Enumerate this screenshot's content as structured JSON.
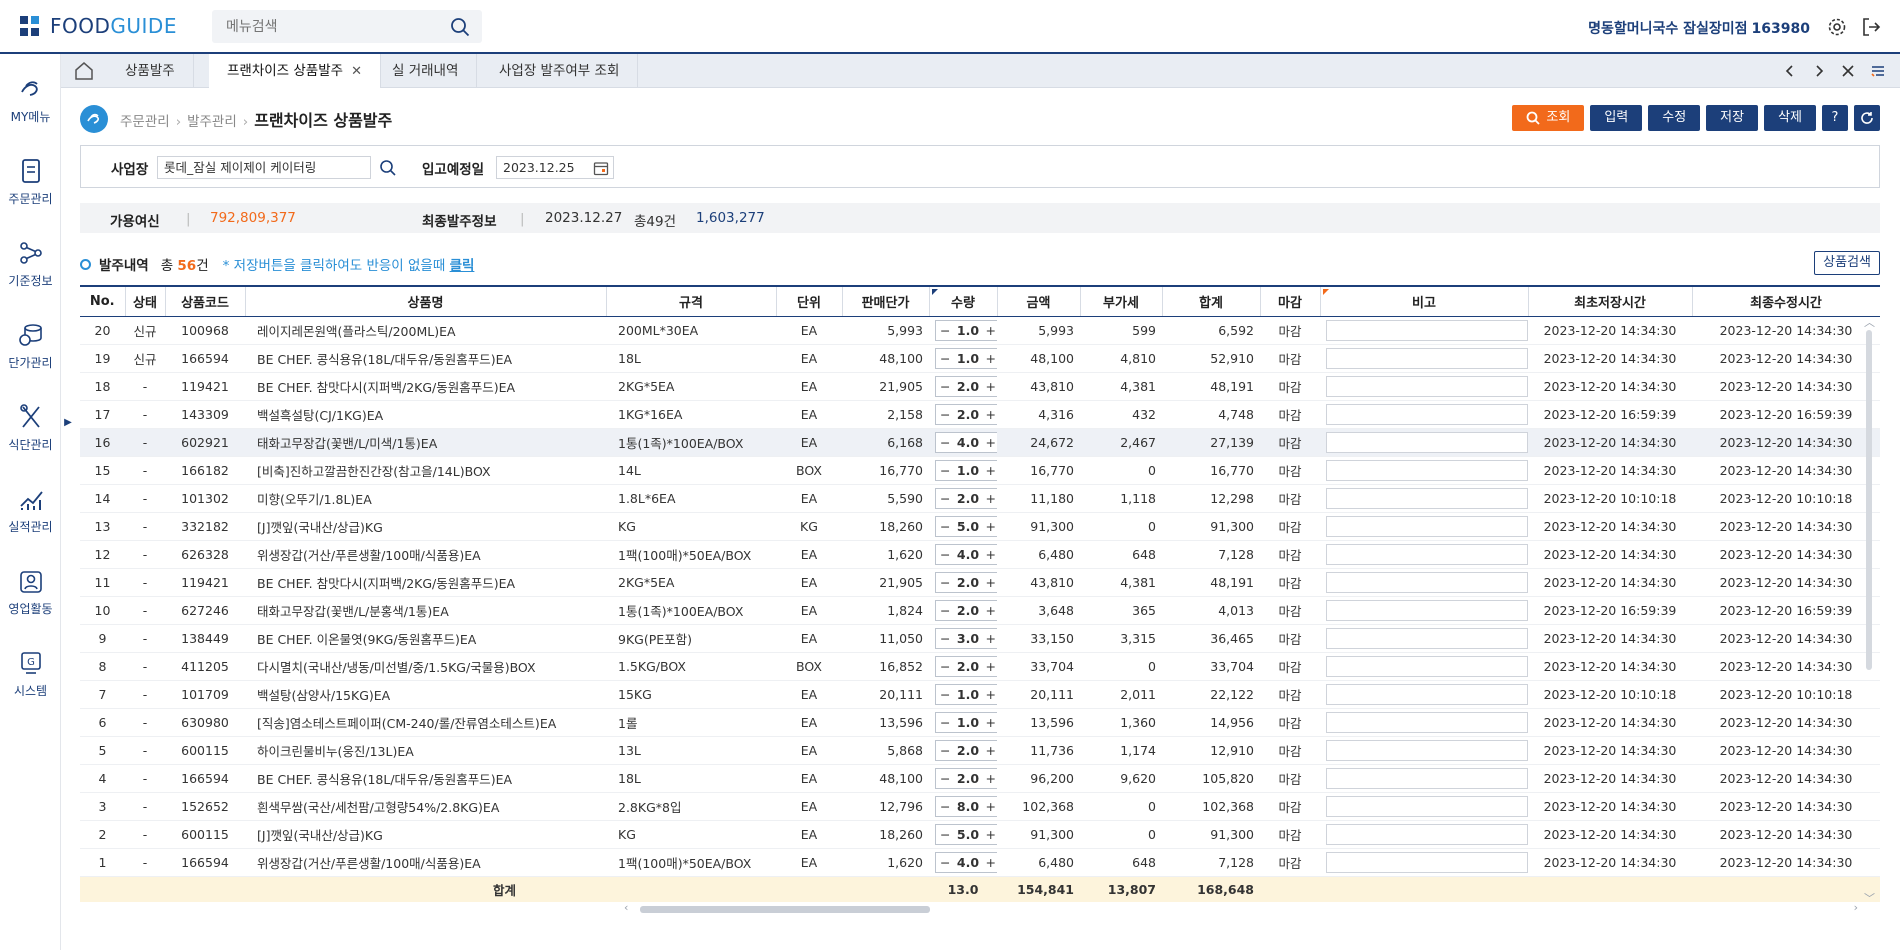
{
  "app": {
    "logo_text_a": "FOOD",
    "logo_text_b": "GUIDE"
  },
  "search": {
    "placeholder": "메뉴검색"
  },
  "user": {
    "name": "명동할머니국수 잠실장미점",
    "code": "163980"
  },
  "sidebar": [
    {
      "label": "MY메뉴",
      "icon": "heart-hands-icon"
    },
    {
      "label": "주문관리",
      "icon": "order-document-icon"
    },
    {
      "label": "기준정보",
      "icon": "share-nodes-icon"
    },
    {
      "label": "단가관리",
      "icon": "coins-icon"
    },
    {
      "label": "식단관리",
      "icon": "fork-spoon-icon"
    },
    {
      "label": "실적관리",
      "icon": "chart-line-icon"
    },
    {
      "label": "영업활동",
      "icon": "person-id-icon"
    },
    {
      "label": "시스템",
      "icon": "system-g-icon"
    }
  ],
  "tabs": [
    {
      "label": "상품발주",
      "active": false,
      "closable": false
    },
    {
      "label": "프랜차이즈 상품발주",
      "active": true,
      "closable": true
    },
    {
      "label": "실 거래내역",
      "active": false,
      "closable": false
    },
    {
      "label": "사업장 발주여부 조회",
      "active": false,
      "closable": false
    }
  ],
  "breadcrumb": {
    "level1": "주문관리",
    "level2": "발주관리",
    "current": "프랜차이즈 상품발주"
  },
  "toolbar": {
    "query": "조회",
    "input": "입력",
    "edit": "수정",
    "save": "저장",
    "delete": "삭제",
    "help": "?"
  },
  "filter": {
    "site_label": "사업장",
    "site_value": "롯데_잠실 제이제이 케이터링",
    "date_label": "입고예정일",
    "date_value": "2023.12.25"
  },
  "info": {
    "credit_label": "가용여신",
    "credit_value": "792,809,377",
    "last_order_label": "최종발주정보",
    "last_order_date": "2023.12.27",
    "last_order_count": "총49건",
    "last_order_amount": "1,603,277"
  },
  "orders": {
    "title": "발주내역",
    "count_prefix": "총",
    "count": "56",
    "count_suffix": "건",
    "note": "* 저장버튼을 클릭하여도 반응이 없을때",
    "note_link": "클릭",
    "product_search": "상품검색"
  },
  "columns": [
    "No.",
    "상태",
    "상품코드",
    "상품명",
    "규격",
    "단위",
    "판매단가",
    "수량",
    "금액",
    "부가세",
    "합계",
    "마감",
    "비고",
    "최초저장시간",
    "최종수정시간"
  ],
  "rows": [
    [
      "20",
      "신규",
      "100968",
      "레이지레몬원액(플라스틱/200ML)EA",
      "200ML*30EA",
      "EA",
      "5,993",
      "1.0",
      "5,993",
      "599",
      "6,592",
      "마감",
      "2023-12-20 14:34:30",
      "2023-12-20 14:34:30"
    ],
    [
      "19",
      "신규",
      "166594",
      "BE CHEF. 콩식용유(18L/대두유/동원홈푸드)EA",
      "18L",
      "EA",
      "48,100",
      "1.0",
      "48,100",
      "4,810",
      "52,910",
      "마감",
      "2023-12-20 14:34:30",
      "2023-12-20 14:34:30"
    ],
    [
      "18",
      "-",
      "119421",
      "BE CHEF. 참맛다시(지퍼백/2KG/동원홈푸드)EA",
      "2KG*5EA",
      "EA",
      "21,905",
      "2.0",
      "43,810",
      "4,381",
      "48,191",
      "마감",
      "2023-12-20 14:34:30",
      "2023-12-20 14:34:30"
    ],
    [
      "17",
      "-",
      "143309",
      "백설흑설탕(CJ/1KG)EA",
      "1KG*16EA",
      "EA",
      "2,158",
      "2.0",
      "4,316",
      "432",
      "4,748",
      "마감",
      "2023-12-20 16:59:39",
      "2023-12-20 16:59:39"
    ],
    [
      "16",
      "-",
      "602921",
      "태화고무장갑(꽃밴/L/미색/1통)EA",
      "1통(1족)*100EA/BOX",
      "EA",
      "6,168",
      "4.0",
      "24,672",
      "2,467",
      "27,139",
      "마감",
      "2023-12-20 14:34:30",
      "2023-12-20 14:34:30"
    ],
    [
      "15",
      "-",
      "166182",
      "[비축]진하고깔끔한진간장(참고을/14L)BOX",
      "14L",
      "BOX",
      "16,770",
      "1.0",
      "16,770",
      "0",
      "16,770",
      "마감",
      "2023-12-20 14:34:30",
      "2023-12-20 14:34:30"
    ],
    [
      "14",
      "-",
      "101302",
      "미향(오뚜기/1.8L)EA",
      "1.8L*6EA",
      "EA",
      "5,590",
      "2.0",
      "11,180",
      "1,118",
      "12,298",
      "마감",
      "2023-12-20 10:10:18",
      "2023-12-20 10:10:18"
    ],
    [
      "13",
      "-",
      "332182",
      "[J]깻잎(국내산/상급)KG",
      "KG",
      "KG",
      "18,260",
      "5.0",
      "91,300",
      "0",
      "91,300",
      "마감",
      "2023-12-20 14:34:30",
      "2023-12-20 14:34:30"
    ],
    [
      "12",
      "-",
      "626328",
      "위생장갑(거산/푸른생활/100매/식품용)EA",
      "1팩(100매)*50EA/BOX",
      "EA",
      "1,620",
      "4.0",
      "6,480",
      "648",
      "7,128",
      "마감",
      "2023-12-20 14:34:30",
      "2023-12-20 14:34:30"
    ],
    [
      "11",
      "-",
      "119421",
      "BE CHEF. 참맛다시(지퍼백/2KG/동원홈푸드)EA",
      "2KG*5EA",
      "EA",
      "21,905",
      "2.0",
      "43,810",
      "4,381",
      "48,191",
      "마감",
      "2023-12-20 14:34:30",
      "2023-12-20 14:34:30"
    ],
    [
      "10",
      "-",
      "627246",
      "태화고무장갑(꽃밴/L/분홍색/1통)EA",
      "1통(1족)*100EA/BOX",
      "EA",
      "1,824",
      "2.0",
      "3,648",
      "365",
      "4,013",
      "마감",
      "2023-12-20 16:59:39",
      "2023-12-20 16:59:39"
    ],
    [
      "9",
      "-",
      "138449",
      "BE CHEF. 이온물엿(9KG/동원홈푸드)EA",
      "9KG(PE포함)",
      "EA",
      "11,050",
      "3.0",
      "33,150",
      "3,315",
      "36,465",
      "마감",
      "2023-12-20 14:34:30",
      "2023-12-20 14:34:30"
    ],
    [
      "8",
      "-",
      "411205",
      "다시멸치(국내산/냉동/미선별/중/1.5KG/국물용)BOX",
      "1.5KG/BOX",
      "BOX",
      "16,852",
      "2.0",
      "33,704",
      "0",
      "33,704",
      "마감",
      "2023-12-20 14:34:30",
      "2023-12-20 14:34:30"
    ],
    [
      "7",
      "-",
      "101709",
      "백설탕(삼양사/15KG)EA",
      "15KG",
      "EA",
      "20,111",
      "1.0",
      "20,111",
      "2,011",
      "22,122",
      "마감",
      "2023-12-20 10:10:18",
      "2023-12-20 10:10:18"
    ],
    [
      "6",
      "-",
      "630980",
      "[직송]염소테스트페이퍼(CM-240/롤/잔류염소테스트)EA",
      "1롤",
      "EA",
      "13,596",
      "1.0",
      "13,596",
      "1,360",
      "14,956",
      "마감",
      "2023-12-20 14:34:30",
      "2023-12-20 14:34:30"
    ],
    [
      "5",
      "-",
      "600115",
      "하이크린물비누(웅진/13L)EA",
      "13L",
      "EA",
      "5,868",
      "2.0",
      "11,736",
      "1,174",
      "12,910",
      "마감",
      "2023-12-20 14:34:30",
      "2023-12-20 14:34:30"
    ],
    [
      "4",
      "-",
      "166594",
      "BE CHEF. 콩식용유(18L/대두유/동원홈푸드)EA",
      "18L",
      "EA",
      "48,100",
      "2.0",
      "96,200",
      "9,620",
      "105,820",
      "마감",
      "2023-12-20 14:34:30",
      "2023-12-20 14:34:30"
    ],
    [
      "3",
      "-",
      "152652",
      "흰색무쌈(국산/세천팜/고형량54%/2.8KG)EA",
      "2.8KG*8입",
      "EA",
      "12,796",
      "8.0",
      "102,368",
      "0",
      "102,368",
      "마감",
      "2023-12-20 14:34:30",
      "2023-12-20 14:34:30"
    ],
    [
      "2",
      "-",
      "600115",
      "[J]깻잎(국내산/상급)KG",
      "KG",
      "EA",
      "18,260",
      "5.0",
      "91,300",
      "0",
      "91,300",
      "마감",
      "2023-12-20 14:34:30",
      "2023-12-20 14:34:30"
    ],
    [
      "1",
      "-",
      "166594",
      "위생장갑(거산/푸른생활/100매/식품용)EA",
      "1팩(100매)*50EA/BOX",
      "EA",
      "1,620",
      "4.0",
      "6,480",
      "648",
      "7,128",
      "마감",
      "2023-12-20 14:34:30",
      "2023-12-20 14:34:30"
    ]
  ],
  "summary": {
    "label": "합계",
    "qty": "13.0",
    "amount": "154,841",
    "vat": "13,807",
    "total": "168,648"
  },
  "colors": {
    "navy": "#1c3f7a",
    "accent_blue": "#2a8fd6",
    "orange": "#f26a1b",
    "summary_bg": "#fdf4dc"
  }
}
